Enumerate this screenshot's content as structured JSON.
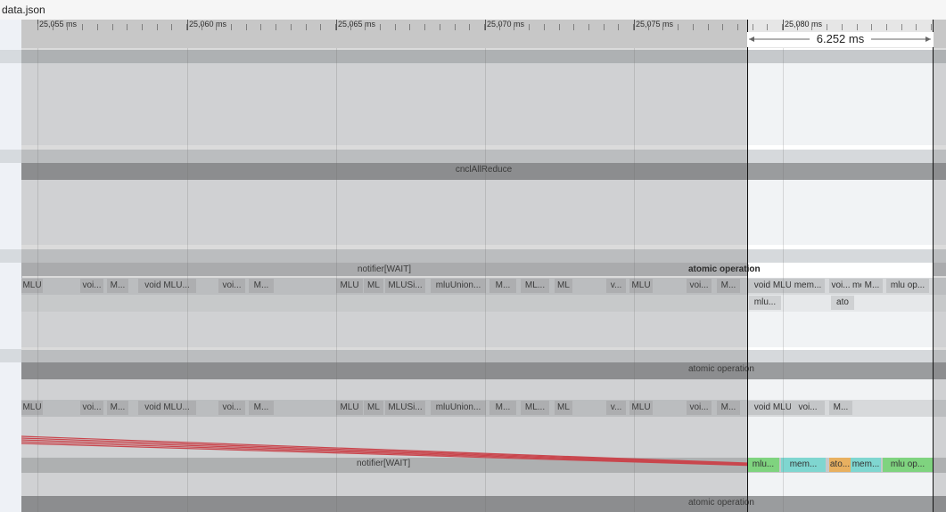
{
  "window": {
    "title": "data.json"
  },
  "ruler": {
    "ticks": [
      "25,055 ms",
      "25,060 ms",
      "25,065 ms",
      "25,070 ms",
      "25,075 ms",
      "25,080 ms"
    ],
    "selection_duration": "6.252 ms"
  },
  "tracks": {
    "cncl_label": "cnclAllReduce",
    "notifier_wait": "notifier[WAIT]",
    "atomic_operation": "atomic operation"
  },
  "row1_slices": [
    "MLU",
    "voi...",
    "M...",
    "void MLU...",
    "voi...",
    "M...",
    "MLU",
    "ML",
    "MLUSi...",
    "mluUnion...",
    "M...",
    "ML...",
    "ML",
    "v...",
    "MLU",
    "voi...",
    "M...",
    "void MLU...",
    "mem...",
    "voi...",
    "mem...",
    "M...",
    "mlu op..."
  ],
  "row1_sub": [
    "mlu...",
    "ato"
  ],
  "row2_slices": [
    "MLU",
    "voi...",
    "M...",
    "void MLU...",
    "voi...",
    "M...",
    "MLU",
    "ML",
    "MLUSi...",
    "mluUnion...",
    "M...",
    "ML...",
    "ML",
    "v...",
    "MLU",
    "voi...",
    "M...",
    "void MLU...",
    "voi...",
    "M..."
  ],
  "flow_slices": [
    "mlu...",
    "mem...",
    "ato...",
    "mem...",
    "mlu op..."
  ],
  "colors": {
    "flow_line": "#e8404a",
    "green_slice": "#7fd37f",
    "teal_slice": "#7fd6d0",
    "orange_slice": "#e8b060"
  }
}
